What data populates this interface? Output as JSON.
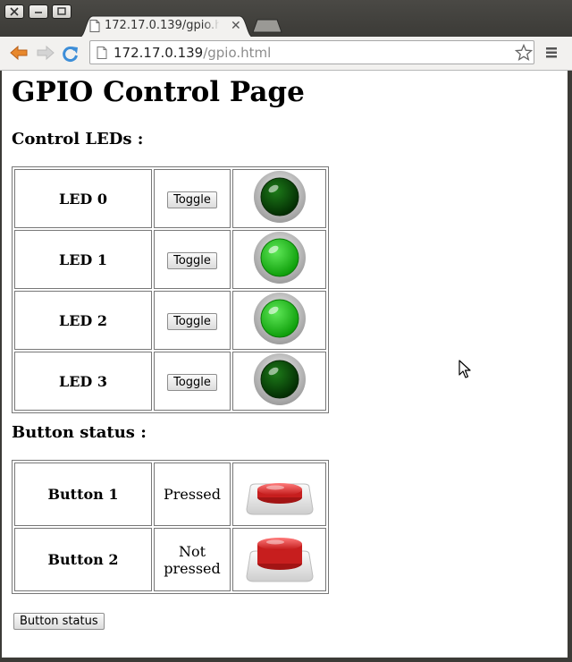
{
  "browser": {
    "tab_title": "172.17.0.139/gpio.html",
    "url_host": "172.17.0.139",
    "url_path": "/gpio.html"
  },
  "page": {
    "title": "GPIO Control Page",
    "leds_heading": "Control LEDs :",
    "leds": [
      {
        "label": "LED 0",
        "button": "Toggle",
        "state": "off"
      },
      {
        "label": "LED 1",
        "button": "Toggle",
        "state": "on"
      },
      {
        "label": "LED 2",
        "button": "Toggle",
        "state": "on"
      },
      {
        "label": "LED 3",
        "button": "Toggle",
        "state": "off"
      }
    ],
    "buttons_heading": "Button status :",
    "buttons": [
      {
        "label": "Button 1",
        "status": "Pressed",
        "pressed": true
      },
      {
        "label": "Button 2",
        "status": "Not pressed",
        "pressed": false
      }
    ],
    "status_button": "Button status"
  },
  "colors": {
    "led_on": "#22c51a",
    "led_off": "#0e4d0c",
    "push_button": "#e53b3b",
    "link_reload": "#3d8ed8",
    "back_arrow": "#e8882c"
  },
  "icons": {
    "back": "back-arrow-icon",
    "forward": "forward-arrow-icon",
    "reload": "reload-icon",
    "bookmark": "star-icon",
    "menu": "hamburger-menu-icon",
    "page": "document-icon"
  }
}
